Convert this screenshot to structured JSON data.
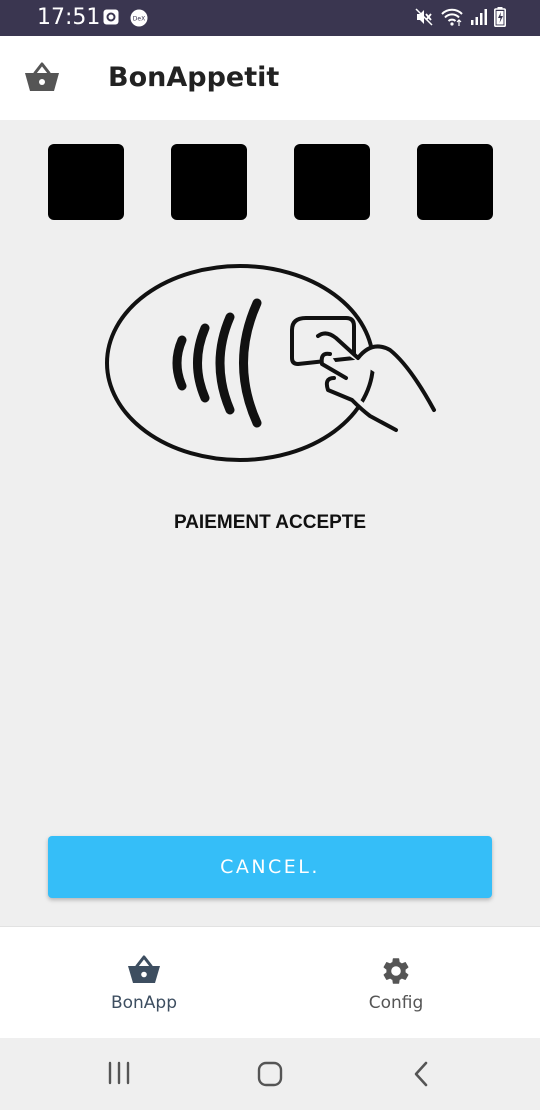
{
  "status_bar": {
    "time": "17:51",
    "left_icons": [
      "screenshot-icon",
      "dex-icon"
    ],
    "right_icons": [
      "mute-icon",
      "wifi-icon",
      "signal-icon",
      "battery-charging-icon"
    ]
  },
  "app_bar": {
    "icon": "basket-icon",
    "title": "BonAppetit"
  },
  "pin_boxes": [
    "",
    "",
    "",
    ""
  ],
  "payment": {
    "icon": "contactless-payment-icon",
    "message": "PAIEMENT ACCEPTE"
  },
  "cancel_button": {
    "label": "CANCEL."
  },
  "bottom_nav": {
    "items": [
      {
        "label": "BonApp",
        "icon": "basket-icon",
        "active": true
      },
      {
        "label": "Config",
        "icon": "gear-icon",
        "active": false
      }
    ]
  },
  "system_nav": {
    "items": [
      "recent-apps-icon",
      "home-icon",
      "back-icon"
    ]
  },
  "colors": {
    "status_bar": "#3a3650",
    "accent": "#35bef8",
    "nav_active": "#3d4e60",
    "nav_inactive": "#555555",
    "background": "#efefef"
  }
}
